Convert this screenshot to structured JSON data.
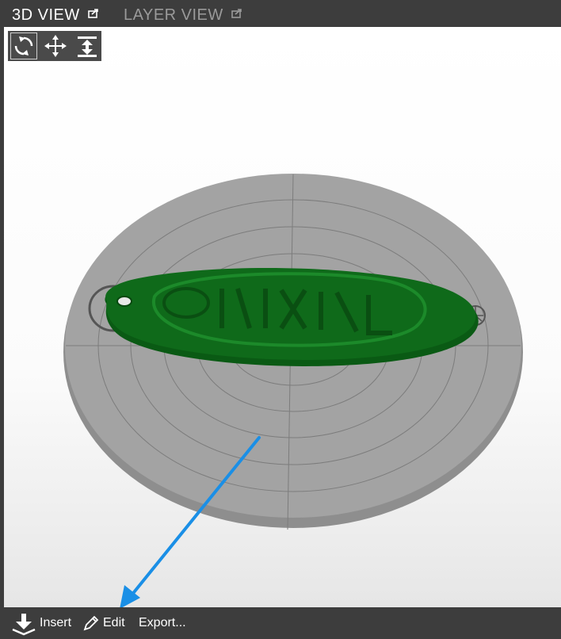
{
  "tabs": {
    "view_3d": "3D VIEW",
    "layer_view": "LAYER VIEW"
  },
  "toolbox": {
    "tools": [
      {
        "icon": "rotate-icon",
        "selected": true
      },
      {
        "icon": "move-icon",
        "selected": false
      },
      {
        "icon": "lay-flat-icon",
        "selected": false
      }
    ]
  },
  "scene": {
    "object_color": "#0f6a1a",
    "bed_color": "#9a9a9a",
    "arrow_color": "#1a8fe6"
  },
  "bottom_toolbar": {
    "insert_label": "Insert",
    "edit_label": "Edit",
    "export_label": "Export..."
  }
}
